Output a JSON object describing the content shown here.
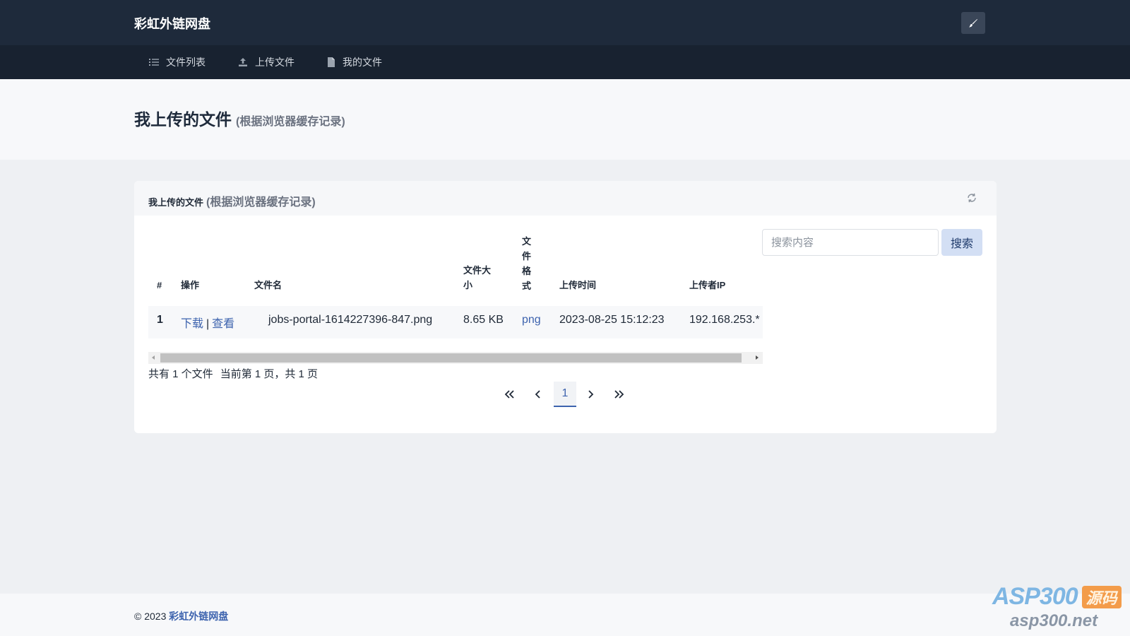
{
  "app": {
    "brand": "彩虹外链网盘"
  },
  "icons": {
    "theme": "brush-icon",
    "refresh": "refresh-icon",
    "nav_list": "list-icon",
    "nav_upload": "upload-icon",
    "nav_file": "file-icon"
  },
  "nav": {
    "items": [
      {
        "label": "文件列表"
      },
      {
        "label": "上传文件"
      },
      {
        "label": "我的文件"
      }
    ]
  },
  "header": {
    "title": "我上传的文件",
    "subtitle": "(根据浏览器缓存记录)"
  },
  "card": {
    "title": "我上传的文件",
    "subtitle": "(根据浏览器缓存记录)",
    "search_placeholder": "搜索内容",
    "search_button": "搜索"
  },
  "table": {
    "headers": {
      "index": "#",
      "action": "操作",
      "filename": "文件名",
      "size": "文件大小",
      "format": "文件格式",
      "time": "上传时间",
      "ip": "上传者IP"
    },
    "rows": [
      {
        "index": "1",
        "download": "下载",
        "separator": "|",
        "view": "查看",
        "filename": "jobs-portal-1614227396-847.png",
        "size": "8.65 KB",
        "format": "png",
        "time": "2023-08-25 15:12:23",
        "ip": "192.168.253.*"
      }
    ]
  },
  "summary": {
    "total": "共有 1 个文件",
    "current": "当前第 1 页，共 1 页"
  },
  "pagination": {
    "first": "«",
    "prev": "‹",
    "current": "1",
    "next": "›",
    "last": "»"
  },
  "footer": {
    "copyright": "© 2023",
    "link": "彩虹外链网盘"
  },
  "watermark": {
    "brand": "ASP300",
    "badge": "源码",
    "site": "asp300.net"
  },
  "colors": {
    "topbar": "#1e2a3b",
    "navbar": "#182230",
    "accent": "#3d63ae",
    "search_button": "#d3dff4"
  }
}
